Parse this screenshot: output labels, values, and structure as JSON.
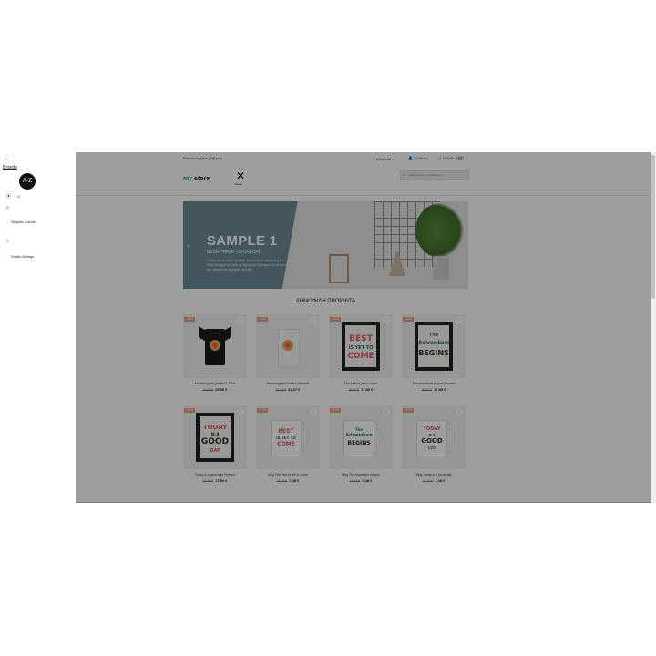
{
  "brands_panel": {
    "back_icon": "arrow-left-icon",
    "brands_link": "Brands",
    "az_badge": "A-Z",
    "letter_g": "G",
    "letter_s": "S",
    "brand_icon_glyph": "⦿",
    "first_letter": "S",
    "brands": [
      "Graphic Corner",
      "Studio Design"
    ]
  },
  "topbar": {
    "contact": "Επικοινωνήστε μαζί μας",
    "language": "Ελληνικά ▾",
    "signin": "Σύνδεση",
    "cart": "Καλάθι",
    "cart_count": "(0)"
  },
  "header": {
    "logo_prefix": "my",
    "logo_suffix": " store",
    "close_label": "Close",
    "search_placeholder": "Αναζήτηση στον κατάλογο"
  },
  "slider": {
    "title": "SAMPLE 1",
    "subtitle": "EXCEPTEUR OCCAECAT",
    "text": "Lorem ipsum dolor sit amet, consectetur adipiscing elit. Proin tristique in tortor et dignissim. Quisque non tempor leo. Maecenas egestas sem elit."
  },
  "section_title": "ΔΗΜΟΦΙΛΗ ΠΡΟΪΟΝΤΑ",
  "products": [
    {
      "name": "Hummingbird printed T-Shirt",
      "old": "23,90 €",
      "new": "29,36 €",
      "badge": "-20%"
    },
    {
      "name": "Hummingbird Printed Sweater",
      "old": "44,07 €",
      "new": "44,07 €",
      "badge": "-20%"
    },
    {
      "name": "The best is yet to come",
      "old": "35,30 €",
      "new": "17,89 €",
      "badge": "-20%"
    },
    {
      "name": "The adventure begins Framed",
      "old": "35,30 €",
      "new": "17,89 €",
      "badge": "-20%"
    },
    {
      "name": "Today is a good day Framed",
      "old": "35,30 €",
      "new": "17,90 €",
      "badge": "-20%"
    },
    {
      "name": "Mug The best is yet to come",
      "old": "14,74 €",
      "new": "7,38 €",
      "badge": "-20%"
    },
    {
      "name": "Mug The adventure begins",
      "old": "14,74 €",
      "new": "7,38 €",
      "badge": "-20%"
    },
    {
      "name": "Mug Today is a good day",
      "old": "14,74 €",
      "new": "7,38 €",
      "badge": "-20%"
    }
  ],
  "colors": {
    "overlay": "#000000",
    "badge": "#f39d72",
    "slide_panel": "#6e8c96",
    "logo_accent": "#2f8fa0"
  }
}
